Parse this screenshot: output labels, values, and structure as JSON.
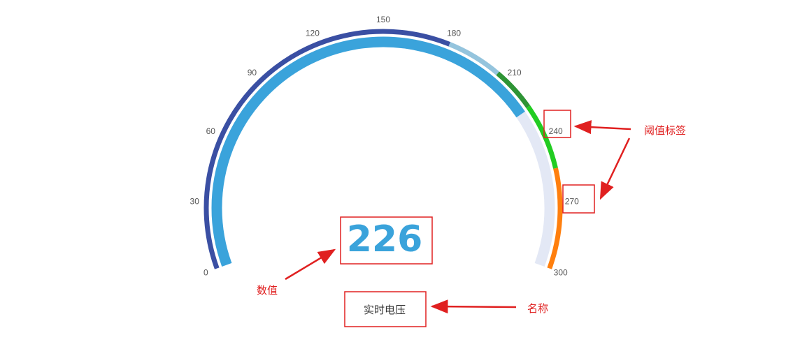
{
  "chart_data": {
    "type": "gauge",
    "min": 0,
    "max": 300,
    "value": 226,
    "value_text": "226",
    "name": "实时电压",
    "tick_labels": [
      "0",
      "30",
      "60",
      "90",
      "120",
      "150",
      "180",
      "210",
      "240",
      "270",
      "300"
    ],
    "axis_segments": [
      {
        "from": 0,
        "to": 180,
        "color": "#3a4fa3"
      },
      {
        "from": 180,
        "to": 205,
        "color": "#94c4dd"
      },
      {
        "from": 205,
        "to": 225,
        "color": "#2e9435"
      },
      {
        "from": 225,
        "to": 255,
        "color": "#22cc22"
      },
      {
        "from": 255,
        "to": 300,
        "color": "#ff7f0e"
      }
    ],
    "progress_color": "#3aa3db",
    "track_color": "#e3e8f5"
  },
  "annotations": {
    "threshold_label": "阈值标签",
    "value_label": "数值",
    "name_label": "名称"
  },
  "colors": {
    "annotation": "#e02020",
    "value": "#3aa3db"
  }
}
